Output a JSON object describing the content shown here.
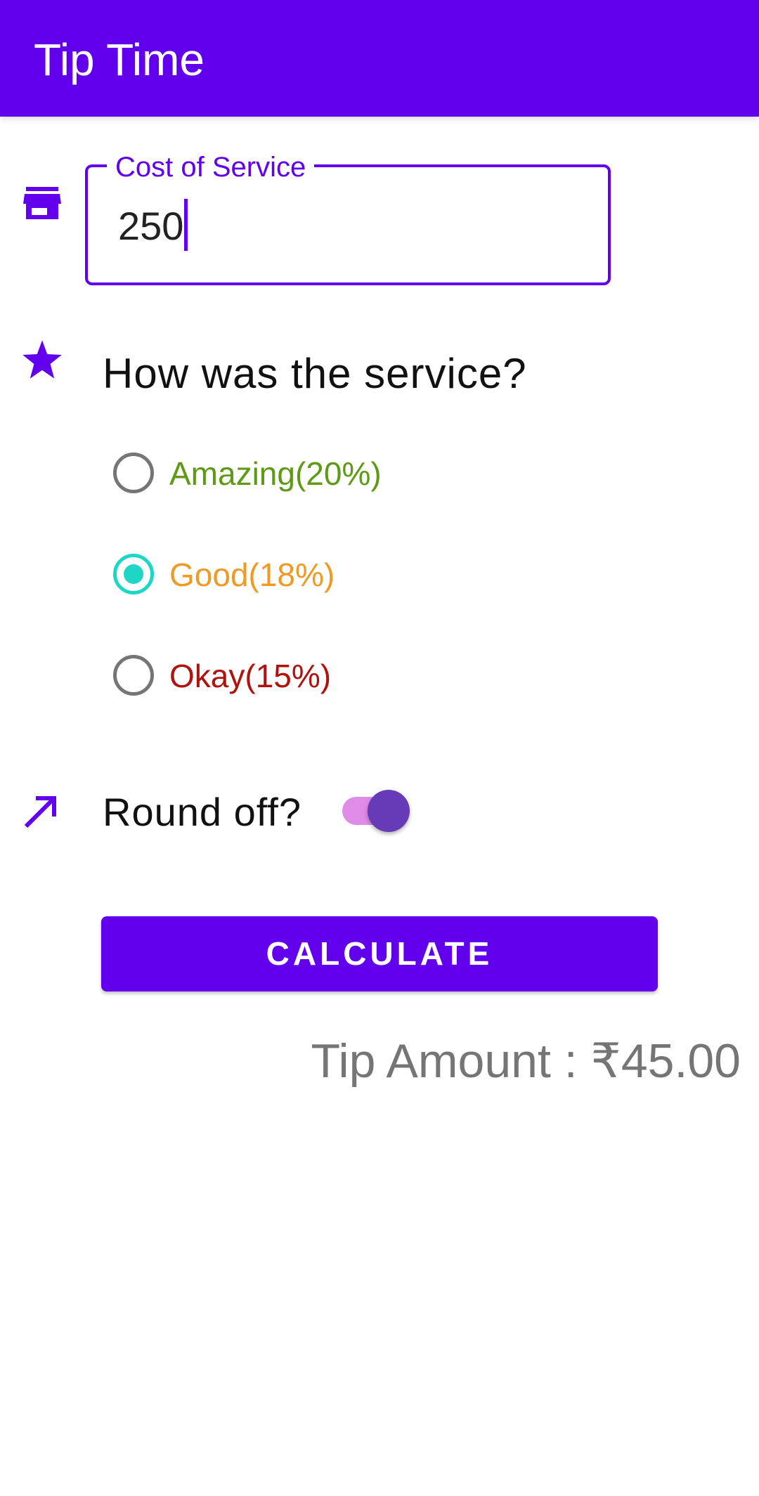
{
  "app_bar": {
    "title": "Tip Time",
    "color": "#6200EE"
  },
  "cost_field": {
    "label": "Cost of Service",
    "value": "250",
    "icon": "storefront-icon"
  },
  "service": {
    "question": "How was the service?",
    "icon": "star-icon",
    "options": [
      {
        "label": "Amazing(20%)",
        "color": "#5E9A16",
        "selected": false
      },
      {
        "label": "Good(18%)",
        "color": "#EE9A25",
        "selected": true
      },
      {
        "label": "Okay(15%)",
        "color": "#B0120E",
        "selected": false
      }
    ],
    "radio_selected_color": "#1DD6C4"
  },
  "round_off": {
    "label": "Round off?",
    "icon": "trending-up-arrow-icon",
    "enabled": true
  },
  "calculate_button": {
    "label": "CALCULATE"
  },
  "result": {
    "tip_amount_text": "Tip Amount : ₹45.00"
  }
}
